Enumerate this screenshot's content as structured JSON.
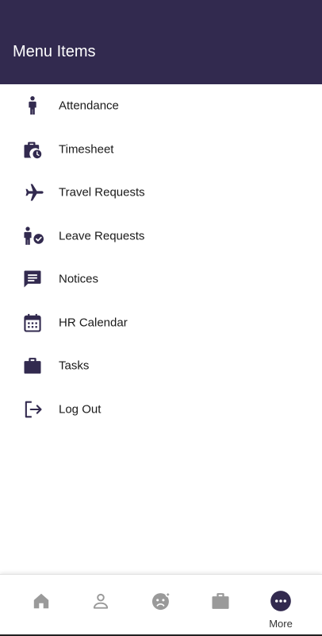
{
  "header": {
    "title": "Menu Items",
    "background": "#322a4f"
  },
  "menu": {
    "items": [
      {
        "label": "Attendance",
        "icon": "person-standing-icon"
      },
      {
        "label": "Timesheet",
        "icon": "briefcase-clock-icon"
      },
      {
        "label": "Travel Requests",
        "icon": "airplane-icon"
      },
      {
        "label": "Leave Requests",
        "icon": "person-check-icon"
      },
      {
        "label": "Notices",
        "icon": "message-icon"
      },
      {
        "label": "HR Calendar",
        "icon": "calendar-icon"
      },
      {
        "label": "Tasks",
        "icon": "briefcase-icon"
      },
      {
        "label": "Log Out",
        "icon": "logout-icon"
      }
    ],
    "icon_color": "#322a4f"
  },
  "bottom_nav": {
    "items": [
      {
        "icon": "home-icon",
        "label": ""
      },
      {
        "icon": "profile-icon",
        "label": ""
      },
      {
        "icon": "face-icon",
        "label": ""
      },
      {
        "icon": "briefcase-icon",
        "label": ""
      },
      {
        "icon": "more-icon",
        "label": "More",
        "active": true
      }
    ],
    "inactive_color": "#9a9a9a",
    "active_color": "#322a4f"
  }
}
